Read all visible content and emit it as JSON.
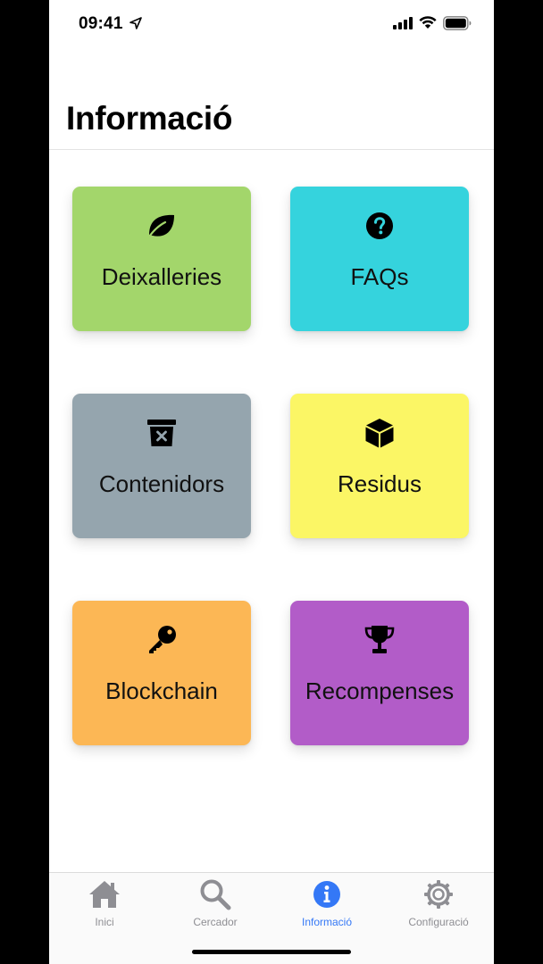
{
  "status_bar": {
    "time": "09:41",
    "icons": [
      "location-arrow-icon",
      "cellular-signal-icon",
      "wifi-icon",
      "battery-icon"
    ]
  },
  "header": {
    "title": "Informació"
  },
  "tiles": [
    {
      "label": "Deixalleries",
      "icon": "leaf-icon",
      "color": "#a3d66b"
    },
    {
      "label": "FAQs",
      "icon": "question-circle-icon",
      "color": "#35d3dd"
    },
    {
      "label": "Contenidors",
      "icon": "trash-bin-icon",
      "color": "#95a5ae"
    },
    {
      "label": "Residus",
      "icon": "cube-icon",
      "color": "#fbf665"
    },
    {
      "label": "Blockchain",
      "icon": "key-icon",
      "color": "#fcb755"
    },
    {
      "label": "Recompenses",
      "icon": "trophy-icon",
      "color": "#b25cc8"
    }
  ],
  "tab_bar": {
    "active_color": "#3478f6",
    "inactive_color": "#8e8e93",
    "tabs": [
      {
        "label": "Inici",
        "icon": "home-icon",
        "active": false
      },
      {
        "label": "Cercador",
        "icon": "search-icon",
        "active": false
      },
      {
        "label": "Informació",
        "icon": "info-circle-icon",
        "active": true
      },
      {
        "label": "Configuració",
        "icon": "gear-icon",
        "active": false
      }
    ]
  }
}
